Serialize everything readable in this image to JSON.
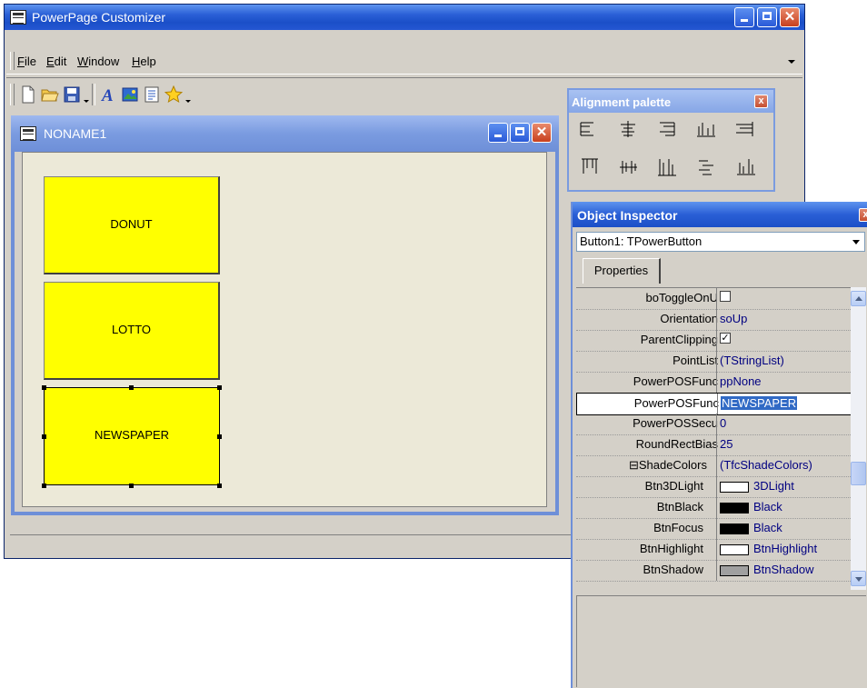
{
  "main_window": {
    "title": "PowerPage Customizer"
  },
  "menu": {
    "items": [
      "File",
      "Edit",
      "Window",
      "Help"
    ]
  },
  "toolbar": {
    "icons": [
      "new-file-icon",
      "open-folder-icon",
      "save-icon",
      "font-icon",
      "image-icon",
      "document-icon",
      "star-icon"
    ]
  },
  "child_window": {
    "title": "NONAME1"
  },
  "buttons": [
    {
      "label": "DONUT",
      "color": "#ffff00"
    },
    {
      "label": "LOTTO",
      "color": "#ffff00"
    },
    {
      "label": "NEWSPAPER",
      "color": "#ffff00"
    }
  ],
  "alignment_palette": {
    "title": "Alignment palette",
    "close": "x"
  },
  "object_inspector": {
    "title": "Object Inspector",
    "close": "x",
    "selected_object": "Button1: TPowerButton",
    "tab": "Properties",
    "properties": [
      {
        "name": "boToggleOnU",
        "value": "",
        "kind": "checkbox",
        "checked": false
      },
      {
        "name": "Orientation",
        "value": "soUp"
      },
      {
        "name": "ParentClipping",
        "value": "",
        "kind": "checkbox",
        "checked": true
      },
      {
        "name": "PointList",
        "value": "(TStringList)"
      },
      {
        "name": "PowerPOSFunc",
        "value": "ppNone"
      },
      {
        "name": "PowerPOSFunc",
        "value": "NEWSPAPER",
        "kind": "editing"
      },
      {
        "name": "PowerPOSSecu",
        "value": "0"
      },
      {
        "name": "RoundRectBias",
        "value": "25"
      },
      {
        "name": "⊟ShadeColors",
        "value": "(TfcShadeColors)"
      },
      {
        "name": "Btn3DLight",
        "value": "3DLight",
        "kind": "color",
        "swatch": "#ffffff"
      },
      {
        "name": "BtnBlack",
        "value": "Black",
        "kind": "color",
        "swatch": "#000000"
      },
      {
        "name": "BtnFocus",
        "value": "Black",
        "kind": "color",
        "swatch": "#000000"
      },
      {
        "name": "BtnHighlight",
        "value": "BtnHighlight",
        "kind": "color",
        "swatch": "#ffffff"
      },
      {
        "name": "BtnShadow",
        "value": "BtnShadow",
        "kind": "color",
        "swatch": "#a0a0a0"
      }
    ]
  }
}
